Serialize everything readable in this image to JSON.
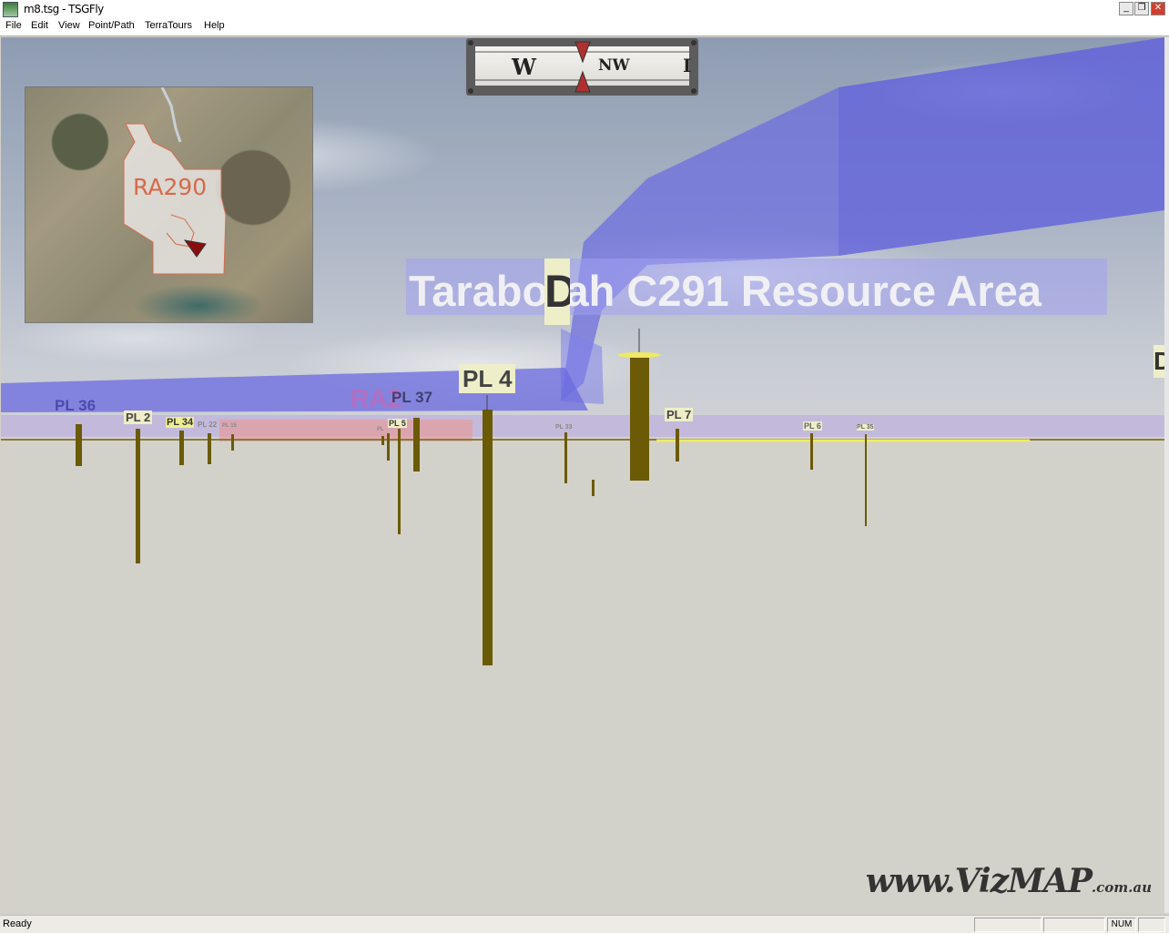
{
  "window": {
    "title": "m8.tsg - TSGFly",
    "controls": [
      "_",
      "❐",
      "✕"
    ]
  },
  "menu": [
    {
      "label": "File",
      "accel": "F"
    },
    {
      "label": "Edit",
      "accel": "E"
    },
    {
      "label": "View",
      "accel": "V"
    },
    {
      "label": "Point/Path",
      "accel": "P"
    },
    {
      "label": "TerraTours",
      "accel": "T"
    },
    {
      "label": "Help",
      "accel": "H"
    }
  ],
  "compass": {
    "left_letter": "W",
    "right_letter": "NW",
    "edge_glyph": "I"
  },
  "minimap": {
    "region_label": "RA290",
    "pointer_icon": "view-direction-arrow-icon"
  },
  "scene": {
    "area_label": "Taraborah C291 Resource Area",
    "ra_label": "RA2",
    "side_labels": [
      "D",
      "D"
    ],
    "pl_labels": {
      "pl36": "PL 36",
      "pl2": "PL 2",
      "pl34": "PL 34",
      "pl22": "PL 22",
      "pl15": "PL 15",
      "pl5": "PL 5",
      "pl37": "PL 37",
      "pl4": "PL 4",
      "pl33": "PL 33",
      "pl7": "PL 7",
      "pl6": "PL 6",
      "pl35": "PL 35",
      "pl_small": "PL"
    },
    "colors": {
      "accent_blue": "#6a6ae0",
      "post_brown": "#6b5a06",
      "label_bg": "#eeeec8",
      "ground": "#d3d2ca"
    }
  },
  "watermark": {
    "main": "www.VizMAP",
    "suffix": ".com.au"
  },
  "status": {
    "text": "Ready",
    "num": "NUM"
  }
}
